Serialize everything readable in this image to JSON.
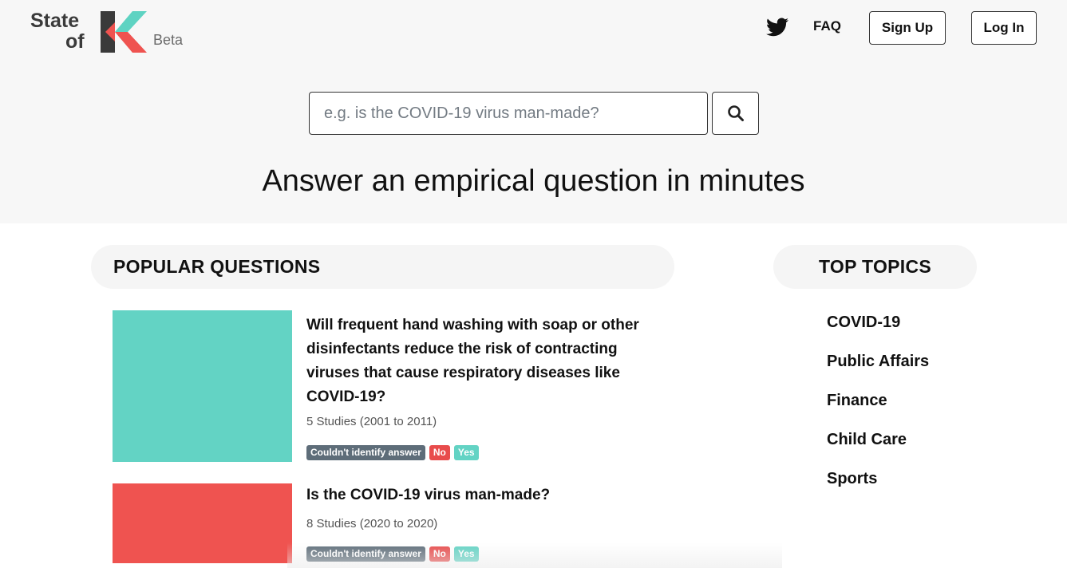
{
  "brand": {
    "line1": "State",
    "line2": "of",
    "beta": "Beta",
    "colors": {
      "dark": "#3a3a3a",
      "red": "#ef5350",
      "teal": "#5ed3c2"
    }
  },
  "nav": {
    "twitter_icon": "twitter-bird-icon",
    "faq": "FAQ",
    "sign_up": "Sign Up",
    "log_in": "Log In"
  },
  "search": {
    "placeholder": "e.g. is the COVID-19 virus man-made?",
    "button_icon": "magnifier-icon"
  },
  "tagline": "Answer an empirical question in minutes",
  "popular": {
    "heading": "POPULAR QUESTIONS",
    "items": [
      {
        "title": "Will frequent hand washing with soap or other disinfectants reduce the risk of contracting viruses that cause respiratory diseases like COVID-19?",
        "studies": "5 Studies (2001 to 2011)",
        "thumb_color": "#63d3c4",
        "tags": [
          "Couldn't identify answer",
          "No",
          "Yes"
        ]
      },
      {
        "title": "Is the COVID-19 virus man-made?",
        "studies": "8 Studies (2020 to 2020)",
        "thumb_color": "#ef5350",
        "tags": [
          "Couldn't identify answer",
          "No",
          "Yes"
        ]
      }
    ]
  },
  "topics": {
    "heading": "TOP TOPICS",
    "items": [
      "COVID-19",
      "Public Affairs",
      "Finance",
      "Child Care",
      "Sports"
    ]
  }
}
